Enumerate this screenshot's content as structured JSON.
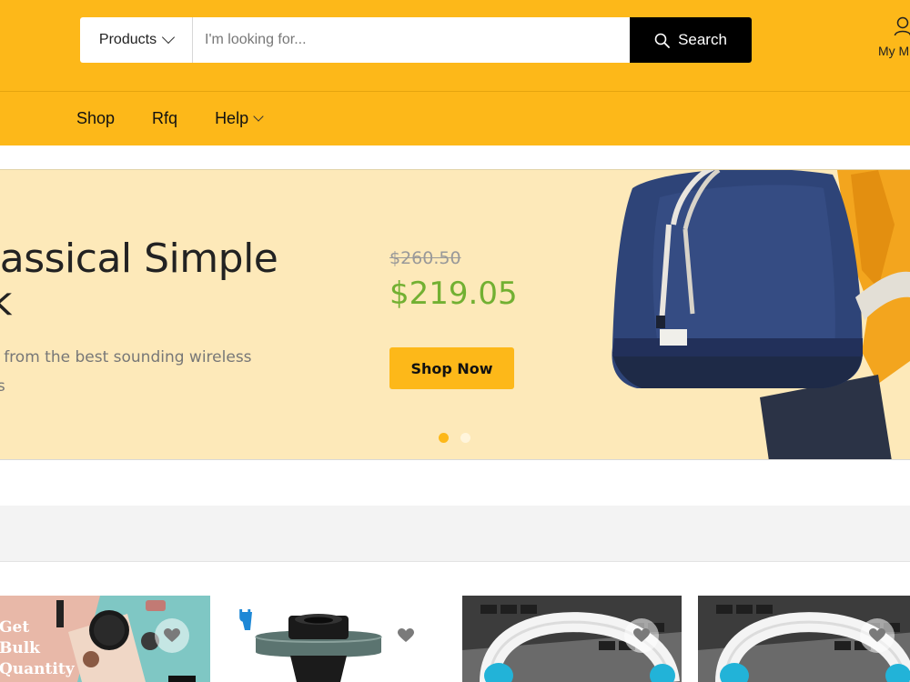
{
  "header": {
    "category_label": "Products",
    "search_placeholder": "I'm looking for...",
    "search_button": "Search",
    "account_label": "My M"
  },
  "nav": {
    "items": [
      {
        "label": "Shop"
      },
      {
        "label": "Rfq"
      },
      {
        "label": "Help"
      }
    ]
  },
  "hero": {
    "title": "lassical Simple\nk",
    "description": "d from the best sounding wireless\nss",
    "price_old": "$260.50",
    "price_new": "$219.05",
    "button": "Shop Now",
    "active_slide": 1,
    "slide_count": 2
  },
  "products": [
    {
      "image": "cosmetics-banner",
      "banner_text": "Get\nBulk\nQuantity"
    },
    {
      "image": "pipe-flange",
      "logo_text": "U"
    },
    {
      "image": "headphones-laptop"
    },
    {
      "image": "headphones-laptop"
    }
  ],
  "colors": {
    "brand_yellow": "#fdb819",
    "hero_bg": "#fde9b9",
    "price_green": "#72b032",
    "search_button_bg": "#000000"
  }
}
